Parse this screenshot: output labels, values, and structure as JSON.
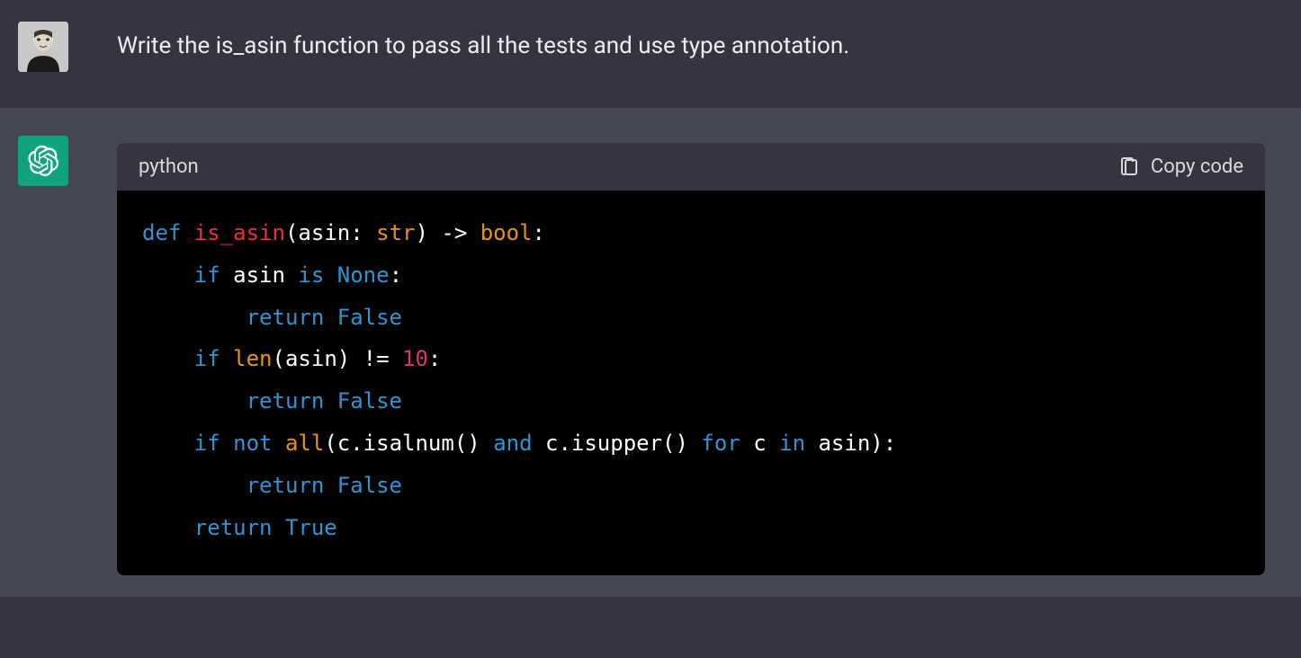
{
  "user": {
    "prompt": "Write the is_asin function to pass all the tests and use type annotation."
  },
  "assistant": {
    "code": {
      "language": "python",
      "copy_label": "Copy code",
      "tokens": {
        "def": "def",
        "fn_name": "is_asin",
        "param_name": "asin",
        "type_str": "str",
        "arrow": " -> ",
        "type_bool": "bool",
        "if1": "if",
        "is": "is",
        "none": "None",
        "return1": "return",
        "false1": "False",
        "if2": "if",
        "len": "len",
        "neq": " != ",
        "ten": "10",
        "return2": "return",
        "false2": "False",
        "if3": "if",
        "not": "not",
        "all": "all",
        "c1": "c",
        "isalnum": ".isalnum()",
        "and": "and",
        "c2": "c",
        "isupper": ".isupper()",
        "for": "for",
        "c3": "c",
        "in": "in",
        "asin2": "asin",
        "return3": "return",
        "false3": "False",
        "return4": "return",
        "true": "True"
      }
    }
  },
  "icons": {
    "copy": "copy-icon"
  }
}
